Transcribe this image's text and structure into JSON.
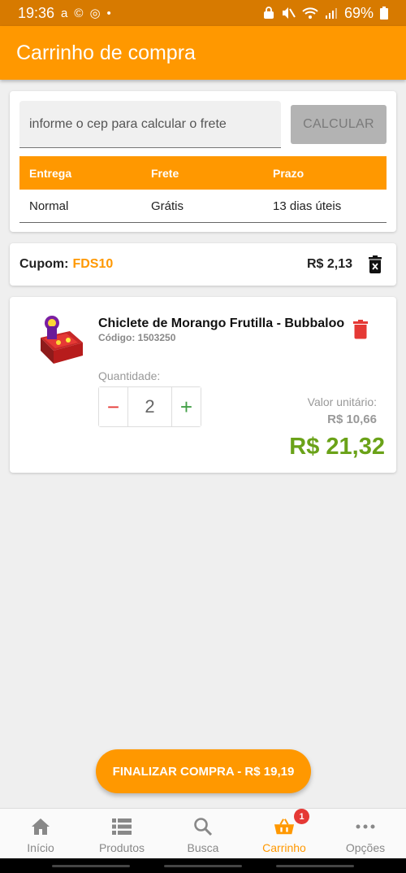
{
  "status_bar": {
    "time": "19:36",
    "app_icons": [
      "a",
      "©",
      "◎",
      "•"
    ],
    "battery": "69%",
    "colors": {
      "bar": "#d77a00"
    }
  },
  "header": {
    "title": "Carrinho de compra"
  },
  "frete": {
    "cep_placeholder": "informe o cep para calcular o frete",
    "calc_label": "CALCULAR",
    "headers": [
      "Entrega",
      "Frete",
      "Prazo"
    ],
    "rows": [
      {
        "entrega": "Normal",
        "frete": "Grátis",
        "prazo": "13 dias úteis"
      }
    ]
  },
  "cupom": {
    "label": "Cupom:",
    "code": "FDS10",
    "value": "R$ 2,13",
    "icon": "delete-forever-icon"
  },
  "item": {
    "name": "Chiclete de Morango Frutilla - Bubbaloo",
    "code": "Código: 1503250",
    "qty_label": "Quantidade:",
    "quantity": "2",
    "minus": "−",
    "plus": "+",
    "unit_label": "Valor unitário:",
    "unit_price": "R$ 10,66",
    "total": "R$ 21,32",
    "icons": {
      "delete": "trash-icon",
      "image": "product-image"
    }
  },
  "checkout": {
    "label": "FINALIZAR COMPRA - R$ 19,19"
  },
  "nav": {
    "items": [
      {
        "label": "Início",
        "icon": "home-icon"
      },
      {
        "label": "Produtos",
        "icon": "list-icon"
      },
      {
        "label": "Busca",
        "icon": "search-icon"
      },
      {
        "label": "Carrinho",
        "icon": "basket-icon",
        "badge": "1"
      },
      {
        "label": "Opções",
        "icon": "more-icon"
      }
    ]
  },
  "colors": {
    "primary": "#ff9800",
    "danger": "#e53935",
    "success": "#43a047",
    "total": "#6aa218"
  }
}
